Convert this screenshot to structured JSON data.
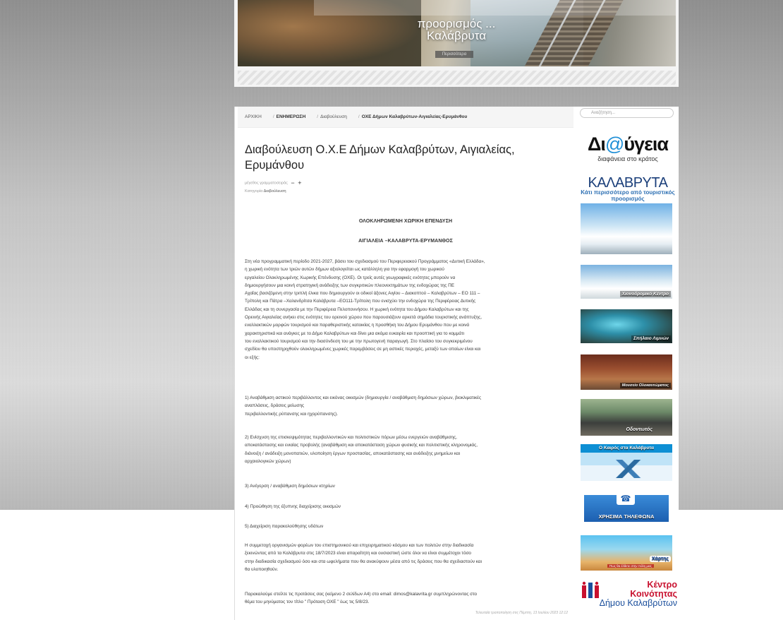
{
  "header": {
    "banner_line1": "προορισμός ...",
    "banner_line2": "Καλάβρυτα",
    "banner_more": "Περισσότερα"
  },
  "breadcrumb": {
    "home": "ΑΡΧΙΚΗ",
    "news": "ΕΝΗΜΕΡΩΣΗ",
    "section": "Διαβούλευση",
    "current": "ΟΧΕ Δήμων Καλαβρύτων-Αιγιαλείας-Ερυμάνθου"
  },
  "article": {
    "title": "Διαβούλευση Ο.Χ.Ε Δήμων Καλαβρύτων, Αιγιαλείας, Ερυμάνθου",
    "font_size_label": "μέγεθος γραμματοσειράς",
    "font_decrease": "−",
    "font_increase": "+",
    "category_label": "Κατηγορία",
    "category_value": "Διαβούλευση",
    "heading1": "ΟΛΟΚΛΗΡΩΜΕΝΗ ΧΩΡΙΚΗ ΕΠΕΝΔΥΣΗ",
    "heading2": "ΑΙΓΙΑΛΕΙΑ –ΚΑΛΑΒΡΥΤΑ-ΕΡΥΜΑΝΘΟΣ",
    "intro_lines": [
      "Στη νέα προγραμματική περίοδο 2021-2027, βάσει του σχεδιασμού του Περιφερειακού Προγράμματος «Δυτική Ελλάδα»,",
      "η χωρική ενότητα των τριών αυτών δήμων αξιολογείται ως κατάλληλη για την εφαρμογή του χωρικού",
      "εργαλείου Ολοκληρωμένης Χωρικής Επένδυσης (ΟΧΕ). Οι τρείς αυτές γεωγραφικές ενότητες μπορούν να",
      "δημιουργήσουν μια κοινή στρατηγική ανάδειξης των συγκριτικών πλεονεκτημάτων της ενδοχώρας της ΠΕ",
      "Αχαΐας βασιζόμενη στην τριπλή έλικα που δημιουργούν οι οδικοί άξονες Αιγίου – Διακοπτού – Καλαβρύτων – ΕΟ 111 –",
      "Τρίπολη και Πάτρα –Χαλανδρίτσα Καλάβρυτα –ΕΟ111-Τρίπολη που ενισχύει την ενδοχώρα της Περιφέρειας Δυτικής",
      "Ελλάδας και τη συνεργασία με την Περιφέρεια Πελοποννήσου. Η χωρική ενότητα του Δήμου Καλαβρύτων και της",
      "Ορεινής Αιγιαλείας ανήκει στις ενότητες του ορεινού χώρου που παρουσιάζουν αρκετά σημάδια τουριστικής ανάπτυξης,",
      "εναλλακτικών μορφών τουρισμού και παραθεριστικής κατοικίας η προσθήκη του Δήμου Ερυμάνθου που με κοινά",
      "χαρακτηριστικά και ανάγκες με το Δήμο Καλαβρύτων και δίνει μια ακόμα ευκαιρία και προοπτική για το κομμάτι",
      "του εναλλακτικού τουρισμού και την διασύνδεση του με την πρωτογενή παραγωγή. Στο πλαίσιο του συγκεκριμένου",
      "σχεδίου θα υποστηριχθούν ολοκληρωμένες χωρικές παρεμβάσεις σε μη αστικές περιοχές, μεταξύ των οποίων είναι και",
      "οι εξής:"
    ],
    "item1_lines": [
      "1) Αναβάθμιση αστικού περιβάλλοντος και εικόνας οικισμών (δημιουργία / αναβάθμιση δημόσιων χώρων, βιοκλιματικές",
      "αναπλάσεις, δράσεις μείωσης",
      "περιβαλλοντικής ρύπανσης και ηχορύπανσης)."
    ],
    "item2_lines": [
      "2) Ενίσχυση της επισκεψιμότητας περιβαλλοντικών και πολιτιστικών πόρων μέσω ενεργειών αναβάθμισης,",
      "αποκατάστασης και ενιαίας προβολής (αναβάθμιση και αποκατάσταση χώρων φυσικής και πολιτιστικής κληρονομιάς,",
      "διάνοιξη / ανάδειξη μονοπατιών, υλοποίηση έργων προστασίας, αποκατάστασης και ανάδειξης μνημείων και",
      "αρχαιολογικών χώρων)"
    ],
    "item3": "3) Ανέγερση / αναβάθμιση δημόσιων κτηρίων",
    "item4": "4) Προώθηση της έξυπνης διαχείρισης οικισμών",
    "item5": "5) Διαχείριση παρακολούθησης υδάτων",
    "participation_lines": [
      "Η συμμετοχή οργανισμών φορέων του επιστημονικού και επιχειρηματικού κόσμου και των πολιτών στην διαδικασία",
      "ξεκινώντας από τα Καλάβρυτα στις 18/7/2023 είναι απαραίτητη και ουσιαστική ώστε όλοι να είναι συμμέτοχοι τόσο",
      "στην διαδικασία σχεδιασμού όσο και στα ωφελήματα που θα ανακύψουν μέσα από τις δράσεις που θα σχεδιαστούν και",
      "θα υλοποιηθούν."
    ],
    "request_lines": [
      "Παρακαλούμε στείλτε τις προτάσεις σας (κείμενο 2 σελίδων Α4) στο email: dimos@kalavrita.gr συμπληρώνοντας στο",
      "θέμα του μηνύματος τον τίτλο \" Πρόταση ΟΧΕ \" έως τις 5/8/23."
    ],
    "last_modified": "Τελευταία τροποποίηση στις Πέμπτη, 13 Ιουλίου 2023 12:12"
  },
  "sidebar": {
    "search_placeholder": "Αναζήτηση...",
    "diavgeia_prefix": "Δι",
    "diavgeia_at": "@",
    "diavgeia_suffix": "ύγεια",
    "diavgeia_sub": "διαφάνεια στο κράτος",
    "kalavryta_title": "ΚΑΛΑΒΡΥΤΑ",
    "kalavryta_sub": "Κάτι περισσότερο από τουριστικός προορισμός",
    "snow_center": "Χιονοδρομικό Κέντρο",
    "lake_cave": "Σπήλαιο Λιμνών",
    "museum": "Μουσείο Ολοκαυτώματος",
    "train": "Οδοντωτός",
    "weather": "Ο Καιρός στα Καλάβρυτα",
    "phones": "ΧΡΗΣΙΜΑ ΤΗΛΕΦΩΝΑ",
    "map_title": "Χάρτης",
    "map_sub": "Πως θα έλθετε στην πόλη μας",
    "community_line1": "Κέντρο",
    "community_line2": "Κοινότητας",
    "community_line3": "Δήμου Καλαβρύτων"
  },
  "colors": {
    "accent_blue": "#1b4f9c",
    "community_red": "#c8102e",
    "diavgeia_blue": "#1e8ed6"
  }
}
